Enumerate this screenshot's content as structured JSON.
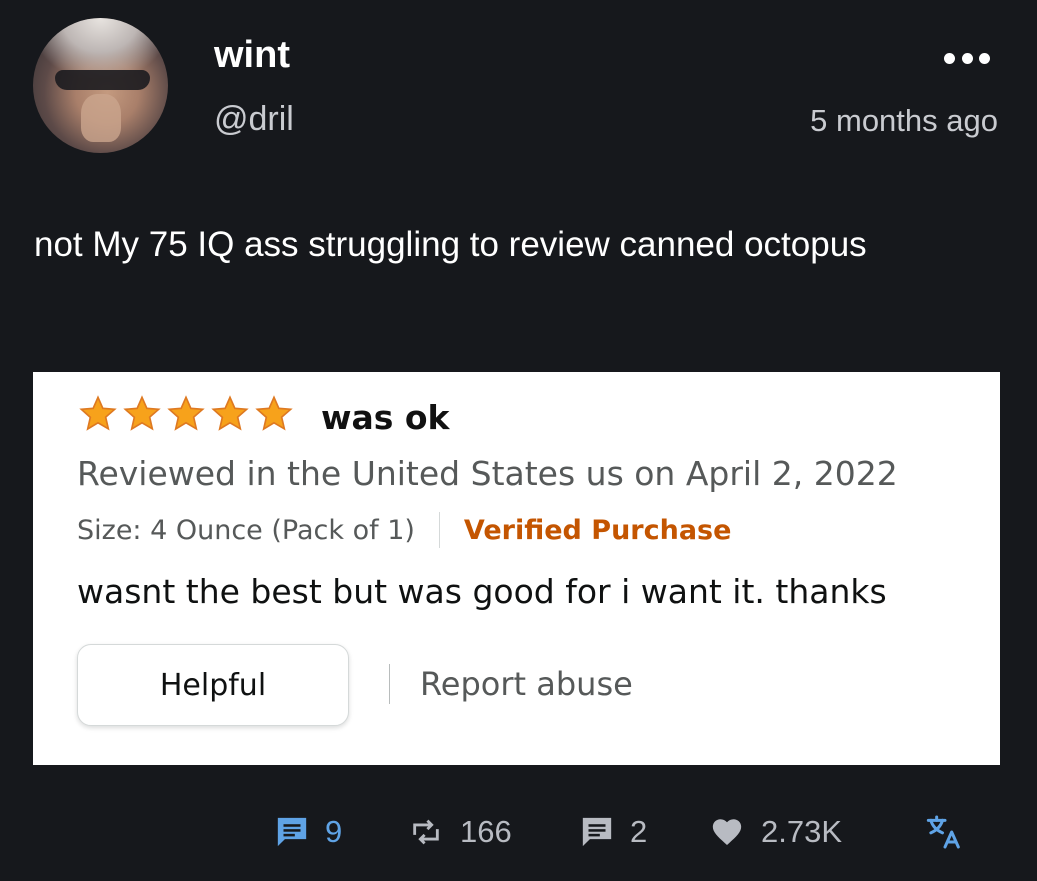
{
  "author": {
    "display_name": "wint",
    "handle": "@dril"
  },
  "timestamp": "5 months ago",
  "post_text": "not My 75 IQ ass struggling to review canned octopus",
  "review": {
    "rating": 5,
    "rating_max": 5,
    "star_color": "#f7a21b",
    "title": "was ok",
    "meta": "Reviewed in the United States us on April 2, 2022",
    "size": "Size: 4 Ounce (Pack of 1)",
    "verified": "Verified Purchase",
    "body": "wasnt the best but was good for i want it. thanks",
    "helpful_label": "Helpful",
    "report_label": "Report abuse"
  },
  "actions": {
    "comments": "9",
    "retweets": "166",
    "quotes": "2",
    "likes": "2.73K"
  },
  "icons": {
    "more": "more-horizontal-icon",
    "comments": "comment-icon",
    "retweets": "retweet-icon",
    "quotes": "quote-icon",
    "likes": "heart-icon",
    "translate": "translate-icon"
  },
  "colors": {
    "background": "#16181c",
    "comment_accent": "#5fa3e6",
    "muted": "#b8bbc2",
    "verified": "#c45500"
  }
}
